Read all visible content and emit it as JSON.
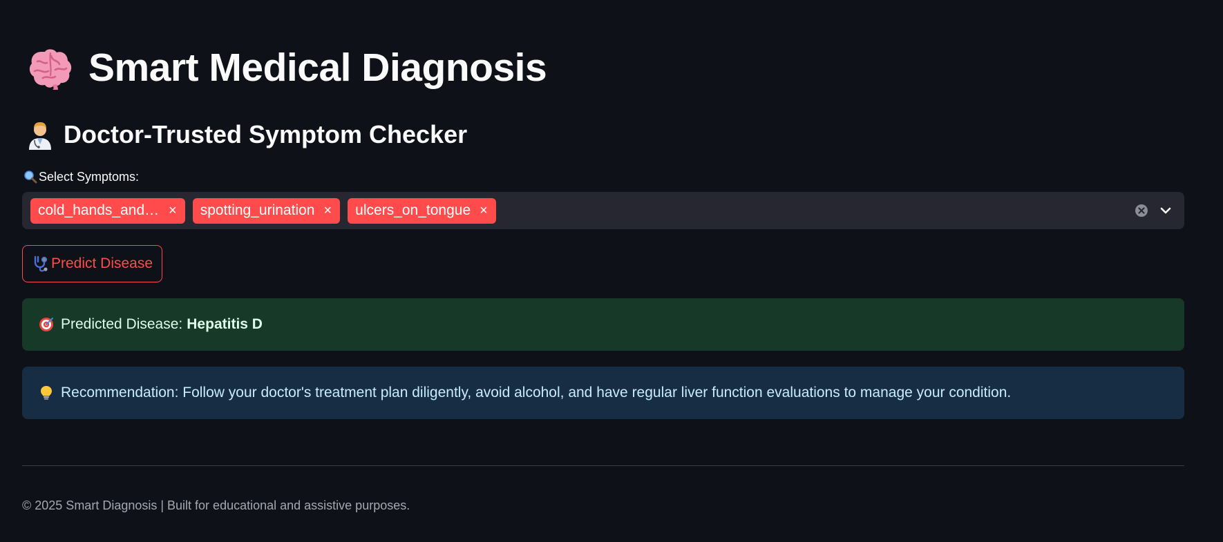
{
  "header": {
    "title": "Smart Medical Diagnosis",
    "title_icon": "brain-icon",
    "subtitle": "Doctor-Trusted Symptom Checker",
    "subtitle_icon": "doctor-icon"
  },
  "symptom_select": {
    "label": "Select Symptoms:",
    "label_icon": "magnifier-icon",
    "selected": [
      {
        "label": "cold_hands_and_feets"
      },
      {
        "label": "spotting_urination"
      },
      {
        "label": "ulcers_on_tongue"
      }
    ],
    "remove_glyph": "×"
  },
  "predict_button": {
    "label": "Predict Disease",
    "icon": "stethoscope-icon"
  },
  "result": {
    "prefix": "Predicted Disease:",
    "disease": "Hepatitis D",
    "icon": "target-icon"
  },
  "recommendation": {
    "text": "Recommendation: Follow your doctor's treatment plan diligently, avoid alcohol, and have regular liver function evaluations to manage your condition.",
    "icon": "lightbulb-icon"
  },
  "footer": {
    "text": "© 2025 Smart Diagnosis | Built for educational and assistive purposes."
  },
  "colors": {
    "background": "#0e1117",
    "accent": "#ff4b4b",
    "success_bg": "#173928",
    "info_bg": "#172d43",
    "input_bg": "#262730"
  }
}
